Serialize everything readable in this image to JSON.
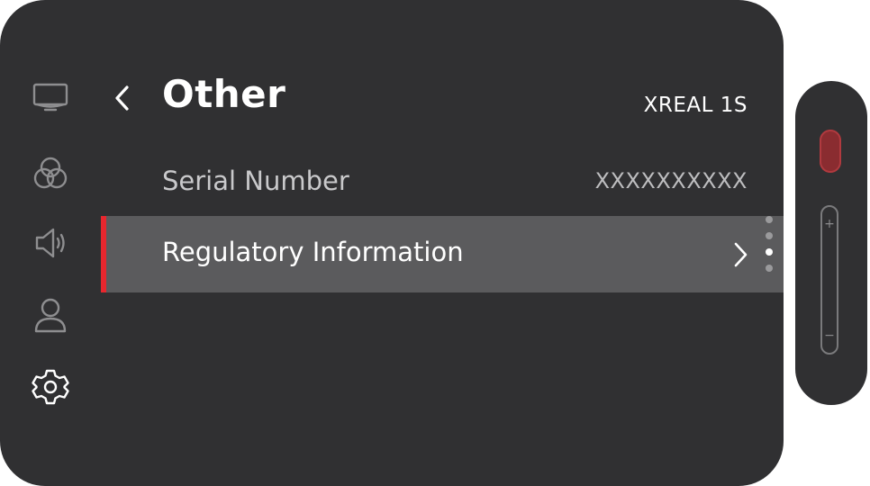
{
  "header": {
    "title": "Other",
    "device_name": "XREAL 1S"
  },
  "sidebar": {
    "items": [
      {
        "icon": "display-icon",
        "name": "display"
      },
      {
        "icon": "color-circles-icon",
        "name": "color"
      },
      {
        "icon": "speaker-icon",
        "name": "sound"
      },
      {
        "icon": "user-icon",
        "name": "account"
      },
      {
        "icon": "gear-icon",
        "name": "settings",
        "active": true
      }
    ]
  },
  "rows": [
    {
      "label": "Serial Number",
      "value": "XXXXXXXXXX"
    },
    {
      "label": "Regulatory Information",
      "selected": true
    }
  ],
  "colors": {
    "panel_bg": "#303032",
    "selected_row_bg": "#5b5b5d",
    "accent": "#e8272e",
    "text_primary": "#ffffff",
    "text_secondary": "#c9c9cb"
  },
  "remote": {
    "volume_up_symbol": "+",
    "volume_down_symbol": "−"
  }
}
